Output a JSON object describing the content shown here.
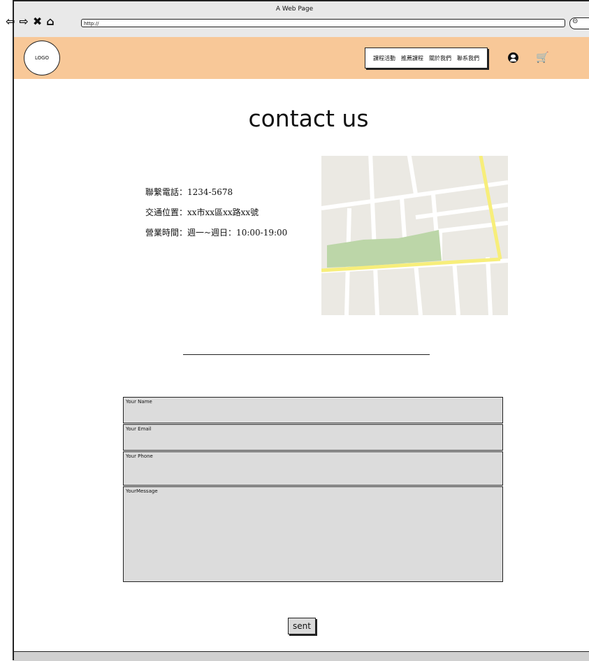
{
  "window": {
    "title": "A Web Page",
    "url": "http://"
  },
  "header": {
    "logo": "LOGO",
    "menu": [
      "課程活動",
      "推薦課程",
      "關於我們",
      "聯系我們"
    ]
  },
  "main": {
    "title": "contact us",
    "info": [
      "聯繫電話：1234-5678",
      "交通位置：xx市xx區xx路xx號",
      "營業時間：週一~週日：10:00-19:00"
    ]
  },
  "form": {
    "name_placeholder": "Your Name",
    "email_placeholder": "Your Email",
    "phone_placeholder": "Your Phone",
    "message_placeholder": "YourMessage",
    "submit_label": "sent"
  },
  "colors": {
    "header_bg": "#f8c898",
    "map_park": "#bcd6a8",
    "map_road_main": "#f7ee7a",
    "map_bg": "#ebe9e3"
  }
}
